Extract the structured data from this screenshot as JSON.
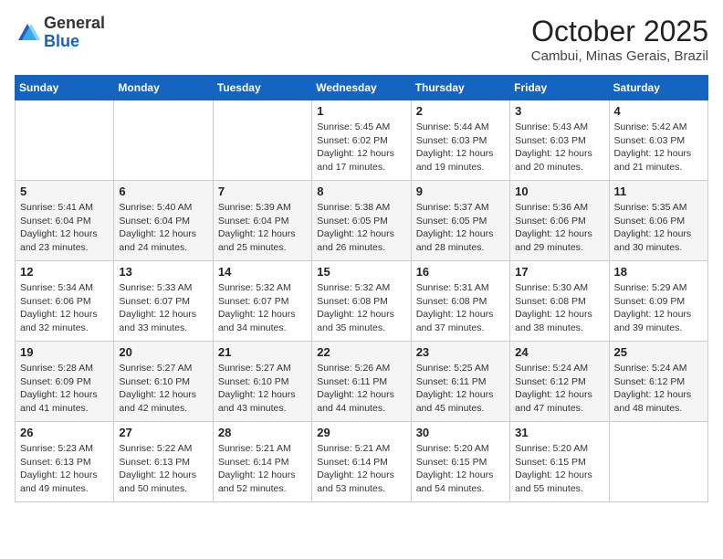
{
  "header": {
    "logo_general": "General",
    "logo_blue": "Blue",
    "month": "October 2025",
    "location": "Cambui, Minas Gerais, Brazil"
  },
  "weekdays": [
    "Sunday",
    "Monday",
    "Tuesday",
    "Wednesday",
    "Thursday",
    "Friday",
    "Saturday"
  ],
  "weeks": [
    [
      {
        "day": "",
        "info": ""
      },
      {
        "day": "",
        "info": ""
      },
      {
        "day": "",
        "info": ""
      },
      {
        "day": "1",
        "info": "Sunrise: 5:45 AM\nSunset: 6:02 PM\nDaylight: 12 hours and 17 minutes."
      },
      {
        "day": "2",
        "info": "Sunrise: 5:44 AM\nSunset: 6:03 PM\nDaylight: 12 hours and 19 minutes."
      },
      {
        "day": "3",
        "info": "Sunrise: 5:43 AM\nSunset: 6:03 PM\nDaylight: 12 hours and 20 minutes."
      },
      {
        "day": "4",
        "info": "Sunrise: 5:42 AM\nSunset: 6:03 PM\nDaylight: 12 hours and 21 minutes."
      }
    ],
    [
      {
        "day": "5",
        "info": "Sunrise: 5:41 AM\nSunset: 6:04 PM\nDaylight: 12 hours and 23 minutes."
      },
      {
        "day": "6",
        "info": "Sunrise: 5:40 AM\nSunset: 6:04 PM\nDaylight: 12 hours and 24 minutes."
      },
      {
        "day": "7",
        "info": "Sunrise: 5:39 AM\nSunset: 6:04 PM\nDaylight: 12 hours and 25 minutes."
      },
      {
        "day": "8",
        "info": "Sunrise: 5:38 AM\nSunset: 6:05 PM\nDaylight: 12 hours and 26 minutes."
      },
      {
        "day": "9",
        "info": "Sunrise: 5:37 AM\nSunset: 6:05 PM\nDaylight: 12 hours and 28 minutes."
      },
      {
        "day": "10",
        "info": "Sunrise: 5:36 AM\nSunset: 6:06 PM\nDaylight: 12 hours and 29 minutes."
      },
      {
        "day": "11",
        "info": "Sunrise: 5:35 AM\nSunset: 6:06 PM\nDaylight: 12 hours and 30 minutes."
      }
    ],
    [
      {
        "day": "12",
        "info": "Sunrise: 5:34 AM\nSunset: 6:06 PM\nDaylight: 12 hours and 32 minutes."
      },
      {
        "day": "13",
        "info": "Sunrise: 5:33 AM\nSunset: 6:07 PM\nDaylight: 12 hours and 33 minutes."
      },
      {
        "day": "14",
        "info": "Sunrise: 5:32 AM\nSunset: 6:07 PM\nDaylight: 12 hours and 34 minutes."
      },
      {
        "day": "15",
        "info": "Sunrise: 5:32 AM\nSunset: 6:08 PM\nDaylight: 12 hours and 35 minutes."
      },
      {
        "day": "16",
        "info": "Sunrise: 5:31 AM\nSunset: 6:08 PM\nDaylight: 12 hours and 37 minutes."
      },
      {
        "day": "17",
        "info": "Sunrise: 5:30 AM\nSunset: 6:08 PM\nDaylight: 12 hours and 38 minutes."
      },
      {
        "day": "18",
        "info": "Sunrise: 5:29 AM\nSunset: 6:09 PM\nDaylight: 12 hours and 39 minutes."
      }
    ],
    [
      {
        "day": "19",
        "info": "Sunrise: 5:28 AM\nSunset: 6:09 PM\nDaylight: 12 hours and 41 minutes."
      },
      {
        "day": "20",
        "info": "Sunrise: 5:27 AM\nSunset: 6:10 PM\nDaylight: 12 hours and 42 minutes."
      },
      {
        "day": "21",
        "info": "Sunrise: 5:27 AM\nSunset: 6:10 PM\nDaylight: 12 hours and 43 minutes."
      },
      {
        "day": "22",
        "info": "Sunrise: 5:26 AM\nSunset: 6:11 PM\nDaylight: 12 hours and 44 minutes."
      },
      {
        "day": "23",
        "info": "Sunrise: 5:25 AM\nSunset: 6:11 PM\nDaylight: 12 hours and 45 minutes."
      },
      {
        "day": "24",
        "info": "Sunrise: 5:24 AM\nSunset: 6:12 PM\nDaylight: 12 hours and 47 minutes."
      },
      {
        "day": "25",
        "info": "Sunrise: 5:24 AM\nSunset: 6:12 PM\nDaylight: 12 hours and 48 minutes."
      }
    ],
    [
      {
        "day": "26",
        "info": "Sunrise: 5:23 AM\nSunset: 6:13 PM\nDaylight: 12 hours and 49 minutes."
      },
      {
        "day": "27",
        "info": "Sunrise: 5:22 AM\nSunset: 6:13 PM\nDaylight: 12 hours and 50 minutes."
      },
      {
        "day": "28",
        "info": "Sunrise: 5:21 AM\nSunset: 6:14 PM\nDaylight: 12 hours and 52 minutes."
      },
      {
        "day": "29",
        "info": "Sunrise: 5:21 AM\nSunset: 6:14 PM\nDaylight: 12 hours and 53 minutes."
      },
      {
        "day": "30",
        "info": "Sunrise: 5:20 AM\nSunset: 6:15 PM\nDaylight: 12 hours and 54 minutes."
      },
      {
        "day": "31",
        "info": "Sunrise: 5:20 AM\nSunset: 6:15 PM\nDaylight: 12 hours and 55 minutes."
      },
      {
        "day": "",
        "info": ""
      }
    ]
  ]
}
